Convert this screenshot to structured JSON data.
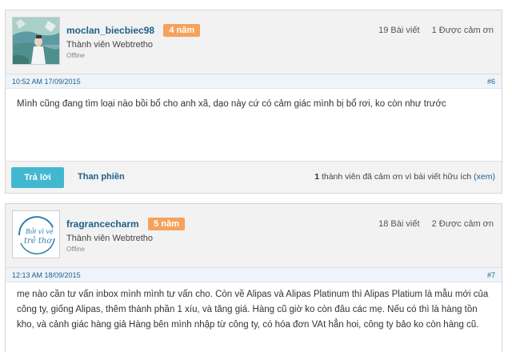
{
  "posts": [
    {
      "username": "moclan_biecbiec98",
      "years": "4 năm",
      "rank": "Thành viên Webtretho",
      "status": "Offline",
      "post_count": "19 Bài viết",
      "thanked_count": "1 Được cảm ơn",
      "date": "10:52 AM 17/09/2015",
      "post_number": "#6",
      "content": "Mình cũng đang tìm loại nào bồi bổ cho anh xã, dạo này cứ có cảm giác mình bị bổ rơi, ko còn như trước",
      "reply_label": "Trả lời",
      "report_label": "Than phiền",
      "thanks_count": "1",
      "thanks_text": " thành viên đã cảm ơn vì bài viết hữu ích ",
      "thanks_link": "(xem)"
    },
    {
      "username": "fragrancecharm",
      "years": "5 năm",
      "rank": "Thành viên Webtretho",
      "status": "Offline",
      "post_count": "18 Bài viết",
      "thanked_count": "2 Được cảm ơn",
      "date": "12:13 AM 18/09/2015",
      "post_number": "#7",
      "avatar_text_top": "Bởi vì vẻ",
      "avatar_text_bottom": "trẻ thơ",
      "content": "mẹ nào cần tư vấn inbox mình mình tư vấn cho. Còn về Alipas và Alipas Platinum thì Alipas Platium là mẫu mới của công ty, giống Alipas, thêm thành phần 1 xíu, và tăng giá. Hàng cũ giờ ko còn đâu các mẹ. Nếu có thì là hàng tồn kho, và cảnh giác hàng giả Hàng bên mình nhập từ công ty, có hóa đơn VAt hẳn hoi, công ty bảo ko còn hàng cũ."
    }
  ],
  "colors": {
    "accent_blue": "#1f5f8b",
    "badge_orange": "#f5a25d",
    "reply_button": "#42b8d0"
  }
}
